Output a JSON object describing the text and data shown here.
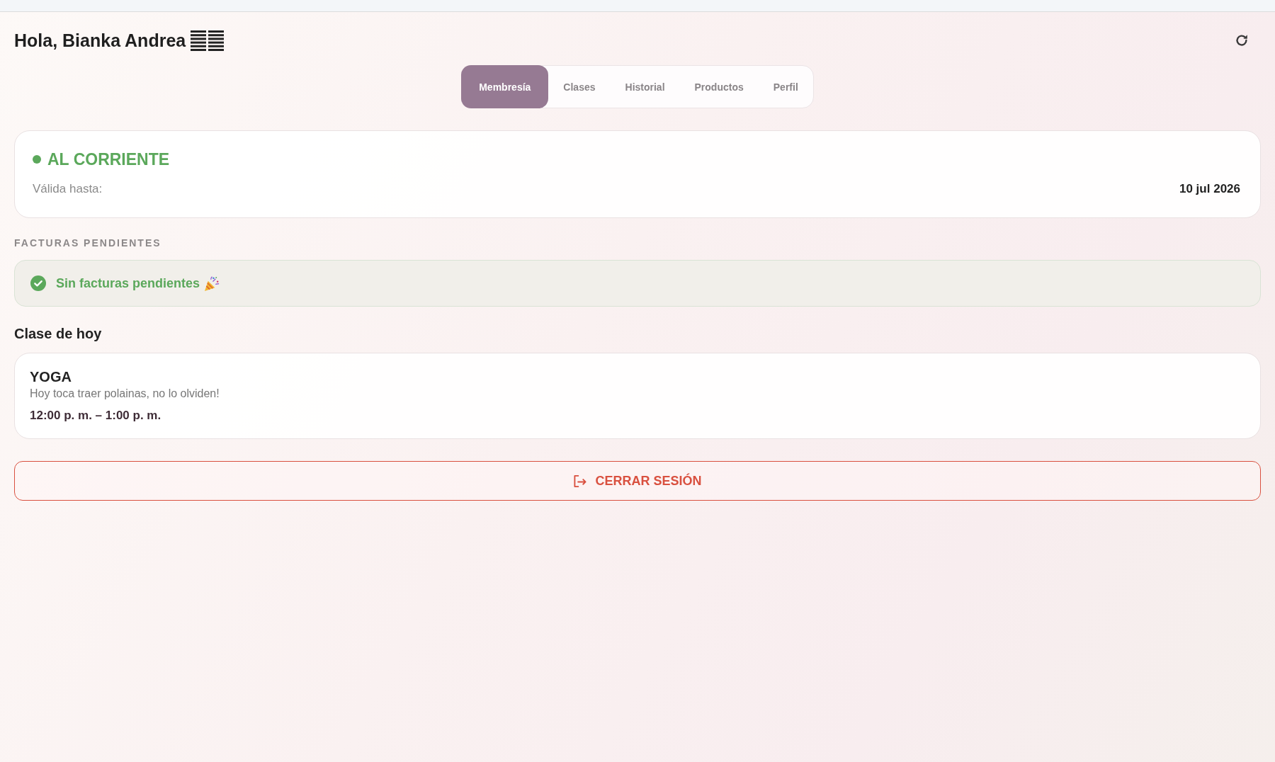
{
  "header": {
    "greeting": "Hola, Bianka Andrea"
  },
  "tabs": [
    {
      "label": "Membresía",
      "selected": true
    },
    {
      "label": "Clases",
      "selected": false
    },
    {
      "label": "Historial",
      "selected": false
    },
    {
      "label": "Productos",
      "selected": false
    },
    {
      "label": "Perfil",
      "selected": false
    }
  ],
  "membership": {
    "status": "AL CORRIENTE",
    "valid_label": "Válida hasta:",
    "valid_until": "10 jul 2026"
  },
  "pending_invoices": {
    "heading": "FACTURAS PENDIENTES",
    "message": "Sin facturas pendientes"
  },
  "today_class": {
    "heading": "Clase de hoy",
    "name": "YOGA",
    "note": "Hoy toca traer polainas, no lo olviden!",
    "time": "12:00 p. m. – 1:00 p. m."
  },
  "logout_button": {
    "label": "CERRAR SESIÓN"
  }
}
